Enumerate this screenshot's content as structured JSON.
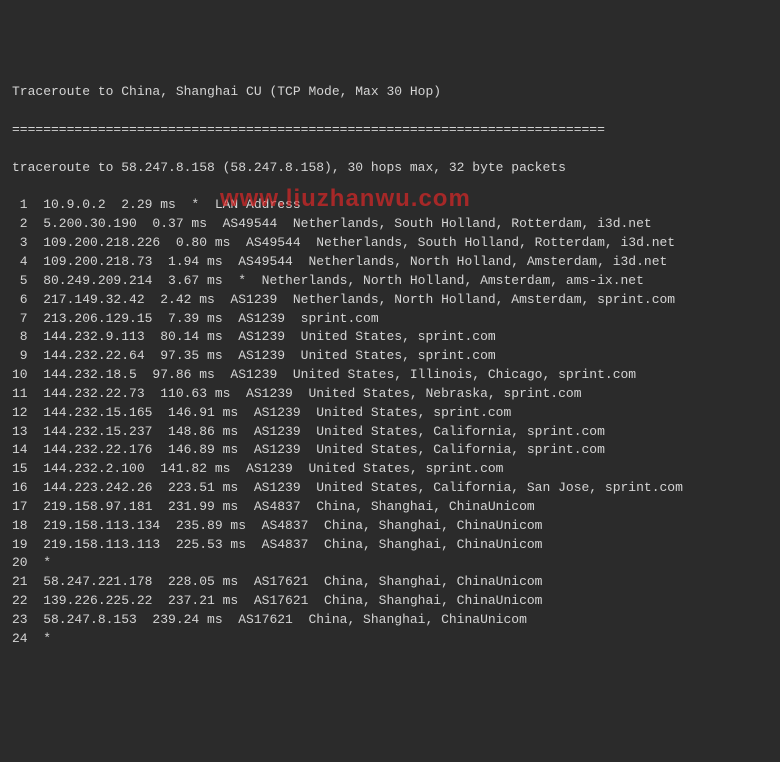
{
  "title": "Traceroute to China, Shanghai CU (TCP Mode, Max 30 Hop)",
  "separator": "============================================================================",
  "header": "traceroute to 58.247.8.158 (58.247.8.158), 30 hops max, 32 byte packets",
  "watermark": "www.liuzhanwu.com",
  "hops": [
    {
      "n": " 1",
      "ip": "10.9.0.2",
      "ms": "2.29 ms",
      "asn": "*",
      "loc": "LAN Address"
    },
    {
      "n": " 2",
      "ip": "5.200.30.190",
      "ms": "0.37 ms",
      "asn": "AS49544",
      "loc": "Netherlands, South Holland, Rotterdam, i3d.net"
    },
    {
      "n": " 3",
      "ip": "109.200.218.226",
      "ms": "0.80 ms",
      "asn": "AS49544",
      "loc": "Netherlands, South Holland, Rotterdam, i3d.net"
    },
    {
      "n": " 4",
      "ip": "109.200.218.73",
      "ms": "1.94 ms",
      "asn": "AS49544",
      "loc": "Netherlands, North Holland, Amsterdam, i3d.net"
    },
    {
      "n": " 5",
      "ip": "80.249.209.214",
      "ms": "3.67 ms",
      "asn": "*",
      "loc": "Netherlands, North Holland, Amsterdam, ams-ix.net"
    },
    {
      "n": " 6",
      "ip": "217.149.32.42",
      "ms": "2.42 ms",
      "asn": "AS1239",
      "loc": "Netherlands, North Holland, Amsterdam, sprint.com"
    },
    {
      "n": " 7",
      "ip": "213.206.129.15",
      "ms": "7.39 ms",
      "asn": "AS1239",
      "loc": "sprint.com"
    },
    {
      "n": " 8",
      "ip": "144.232.9.113",
      "ms": "80.14 ms",
      "asn": "AS1239",
      "loc": "United States, sprint.com"
    },
    {
      "n": " 9",
      "ip": "144.232.22.64",
      "ms": "97.35 ms",
      "asn": "AS1239",
      "loc": "United States, sprint.com"
    },
    {
      "n": "10",
      "ip": "144.232.18.5",
      "ms": "97.86 ms",
      "asn": "AS1239",
      "loc": "United States, Illinois, Chicago, sprint.com"
    },
    {
      "n": "11",
      "ip": "144.232.22.73",
      "ms": "110.63 ms",
      "asn": "AS1239",
      "loc": "United States, Nebraska, sprint.com"
    },
    {
      "n": "12",
      "ip": "144.232.15.165",
      "ms": "146.91 ms",
      "asn": "AS1239",
      "loc": "United States, sprint.com"
    },
    {
      "n": "13",
      "ip": "144.232.15.237",
      "ms": "148.86 ms",
      "asn": "AS1239",
      "loc": "United States, California, sprint.com"
    },
    {
      "n": "14",
      "ip": "144.232.22.176",
      "ms": "146.89 ms",
      "asn": "AS1239",
      "loc": "United States, California, sprint.com"
    },
    {
      "n": "15",
      "ip": "144.232.2.100",
      "ms": "141.82 ms",
      "asn": "AS1239",
      "loc": "United States, sprint.com"
    },
    {
      "n": "16",
      "ip": "144.223.242.26",
      "ms": "223.51 ms",
      "asn": "AS1239",
      "loc": "United States, California, San Jose, sprint.com"
    },
    {
      "n": "17",
      "ip": "219.158.97.181",
      "ms": "231.99 ms",
      "asn": "AS4837",
      "loc": "China, Shanghai, ChinaUnicom"
    },
    {
      "n": "18",
      "ip": "219.158.113.134",
      "ms": "235.89 ms",
      "asn": "AS4837",
      "loc": "China, Shanghai, ChinaUnicom"
    },
    {
      "n": "19",
      "ip": "219.158.113.113",
      "ms": "225.53 ms",
      "asn": "AS4837",
      "loc": "China, Shanghai, ChinaUnicom"
    },
    {
      "n": "20",
      "ip": "*",
      "ms": "",
      "asn": "",
      "loc": ""
    },
    {
      "n": "21",
      "ip": "58.247.221.178",
      "ms": "228.05 ms",
      "asn": "AS17621",
      "loc": "China, Shanghai, ChinaUnicom"
    },
    {
      "n": "22",
      "ip": "139.226.225.22",
      "ms": "237.21 ms",
      "asn": "AS17621",
      "loc": "China, Shanghai, ChinaUnicom"
    },
    {
      "n": "23",
      "ip": "58.247.8.153",
      "ms": "239.24 ms",
      "asn": "AS17621",
      "loc": "China, Shanghai, ChinaUnicom"
    },
    {
      "n": "24",
      "ip": "*",
      "ms": "",
      "asn": "",
      "loc": ""
    }
  ]
}
